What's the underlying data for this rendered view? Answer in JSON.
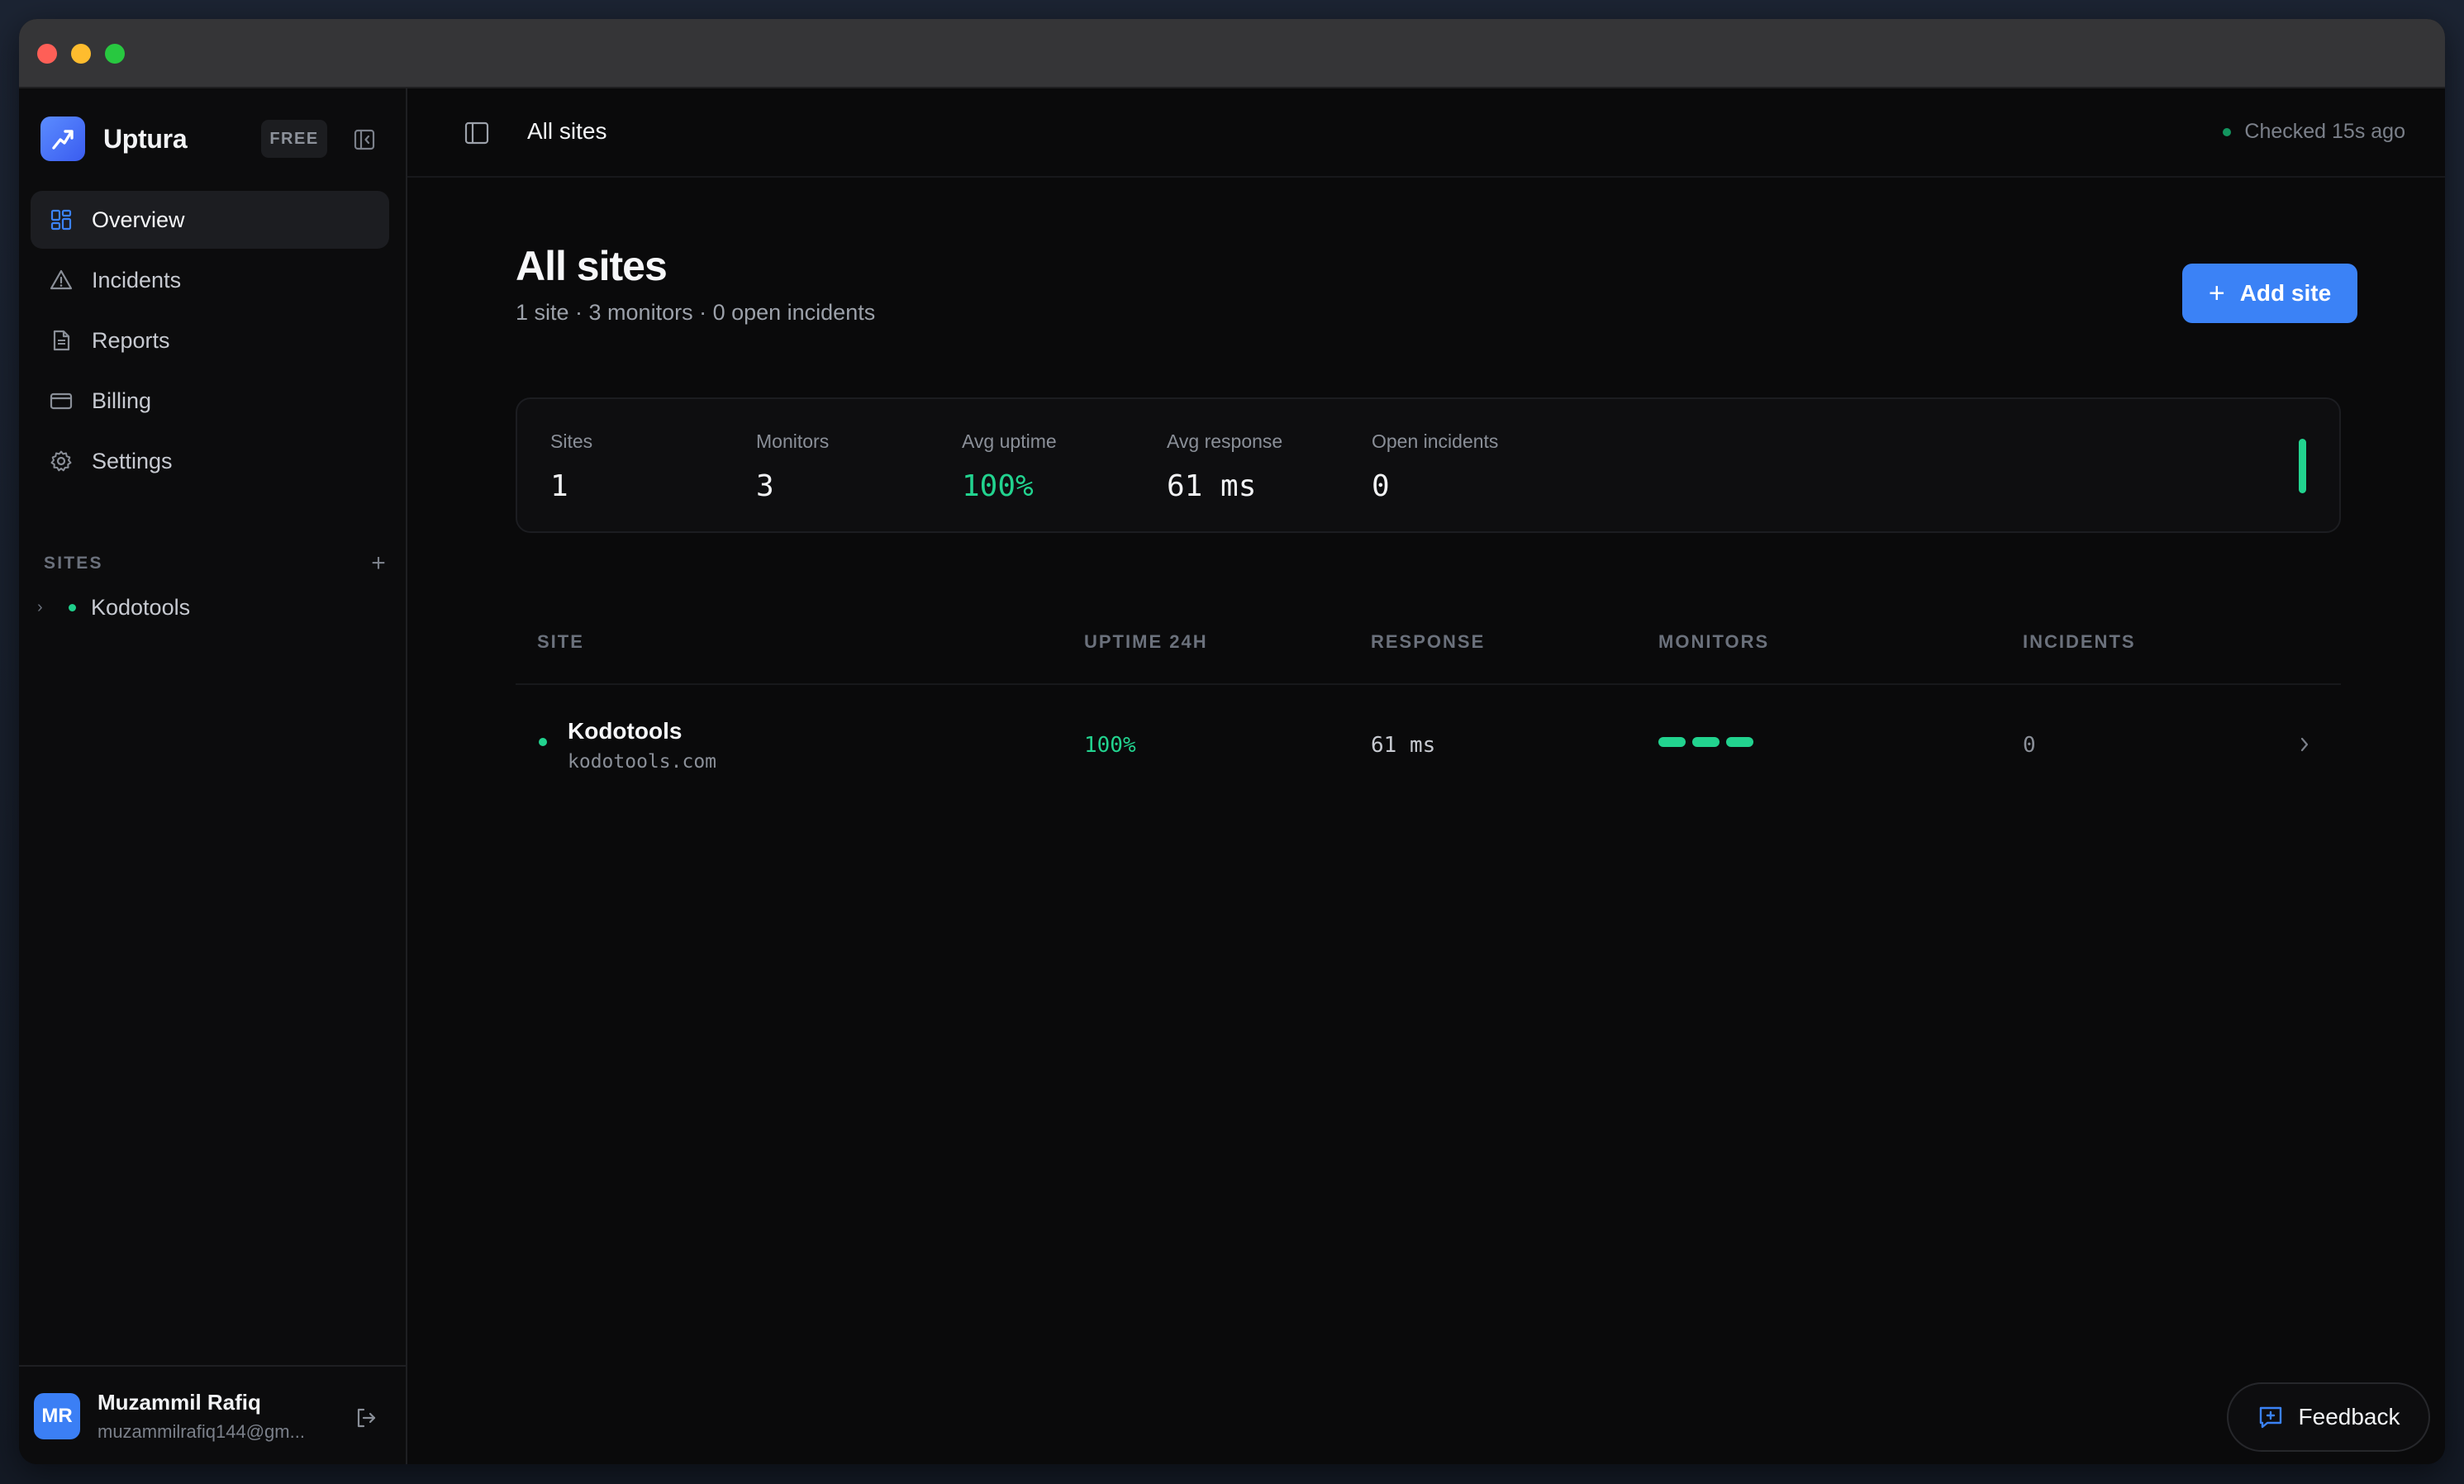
{
  "app": {
    "name": "Uptura",
    "plan_badge": "FREE"
  },
  "sidebar": {
    "items": [
      {
        "label": "Overview",
        "icon": "grid-icon",
        "active": true
      },
      {
        "label": "Incidents",
        "icon": "warning-icon"
      },
      {
        "label": "Reports",
        "icon": "document-icon"
      },
      {
        "label": "Billing",
        "icon": "card-icon"
      },
      {
        "label": "Settings",
        "icon": "gear-icon"
      }
    ],
    "sites_header": "SITES",
    "sites": [
      {
        "name": "Kodotools",
        "status": "up"
      }
    ]
  },
  "user": {
    "initials": "MR",
    "name": "Muzammil Rafiq",
    "email": "muzammilrafiq144@gm..."
  },
  "topbar": {
    "breadcrumb": "All sites",
    "checked": "Checked 15s ago"
  },
  "page": {
    "title": "All sites",
    "subtitle": "1 site · 3 monitors · 0 open incidents",
    "add_button": "Add site"
  },
  "stats": [
    {
      "label": "Sites",
      "value": "1"
    },
    {
      "label": "Monitors",
      "value": "3"
    },
    {
      "label": "Avg uptime",
      "value": "100%"
    },
    {
      "label": "Avg response",
      "value": "61 ms"
    },
    {
      "label": "Open incidents",
      "value": "0"
    }
  ],
  "table": {
    "columns": [
      "SITE",
      "UPTIME 24H",
      "RESPONSE",
      "MONITORS",
      "INCIDENTS"
    ],
    "rows": [
      {
        "name": "Kodotools",
        "domain": "kodotools.com",
        "uptime": "100%",
        "response": "61 ms",
        "monitors": 3,
        "incidents": "0"
      }
    ]
  },
  "feedback_label": "Feedback",
  "colors": {
    "accent": "#3b82f6",
    "success": "#22d38f",
    "background": "#0a0a0b"
  }
}
